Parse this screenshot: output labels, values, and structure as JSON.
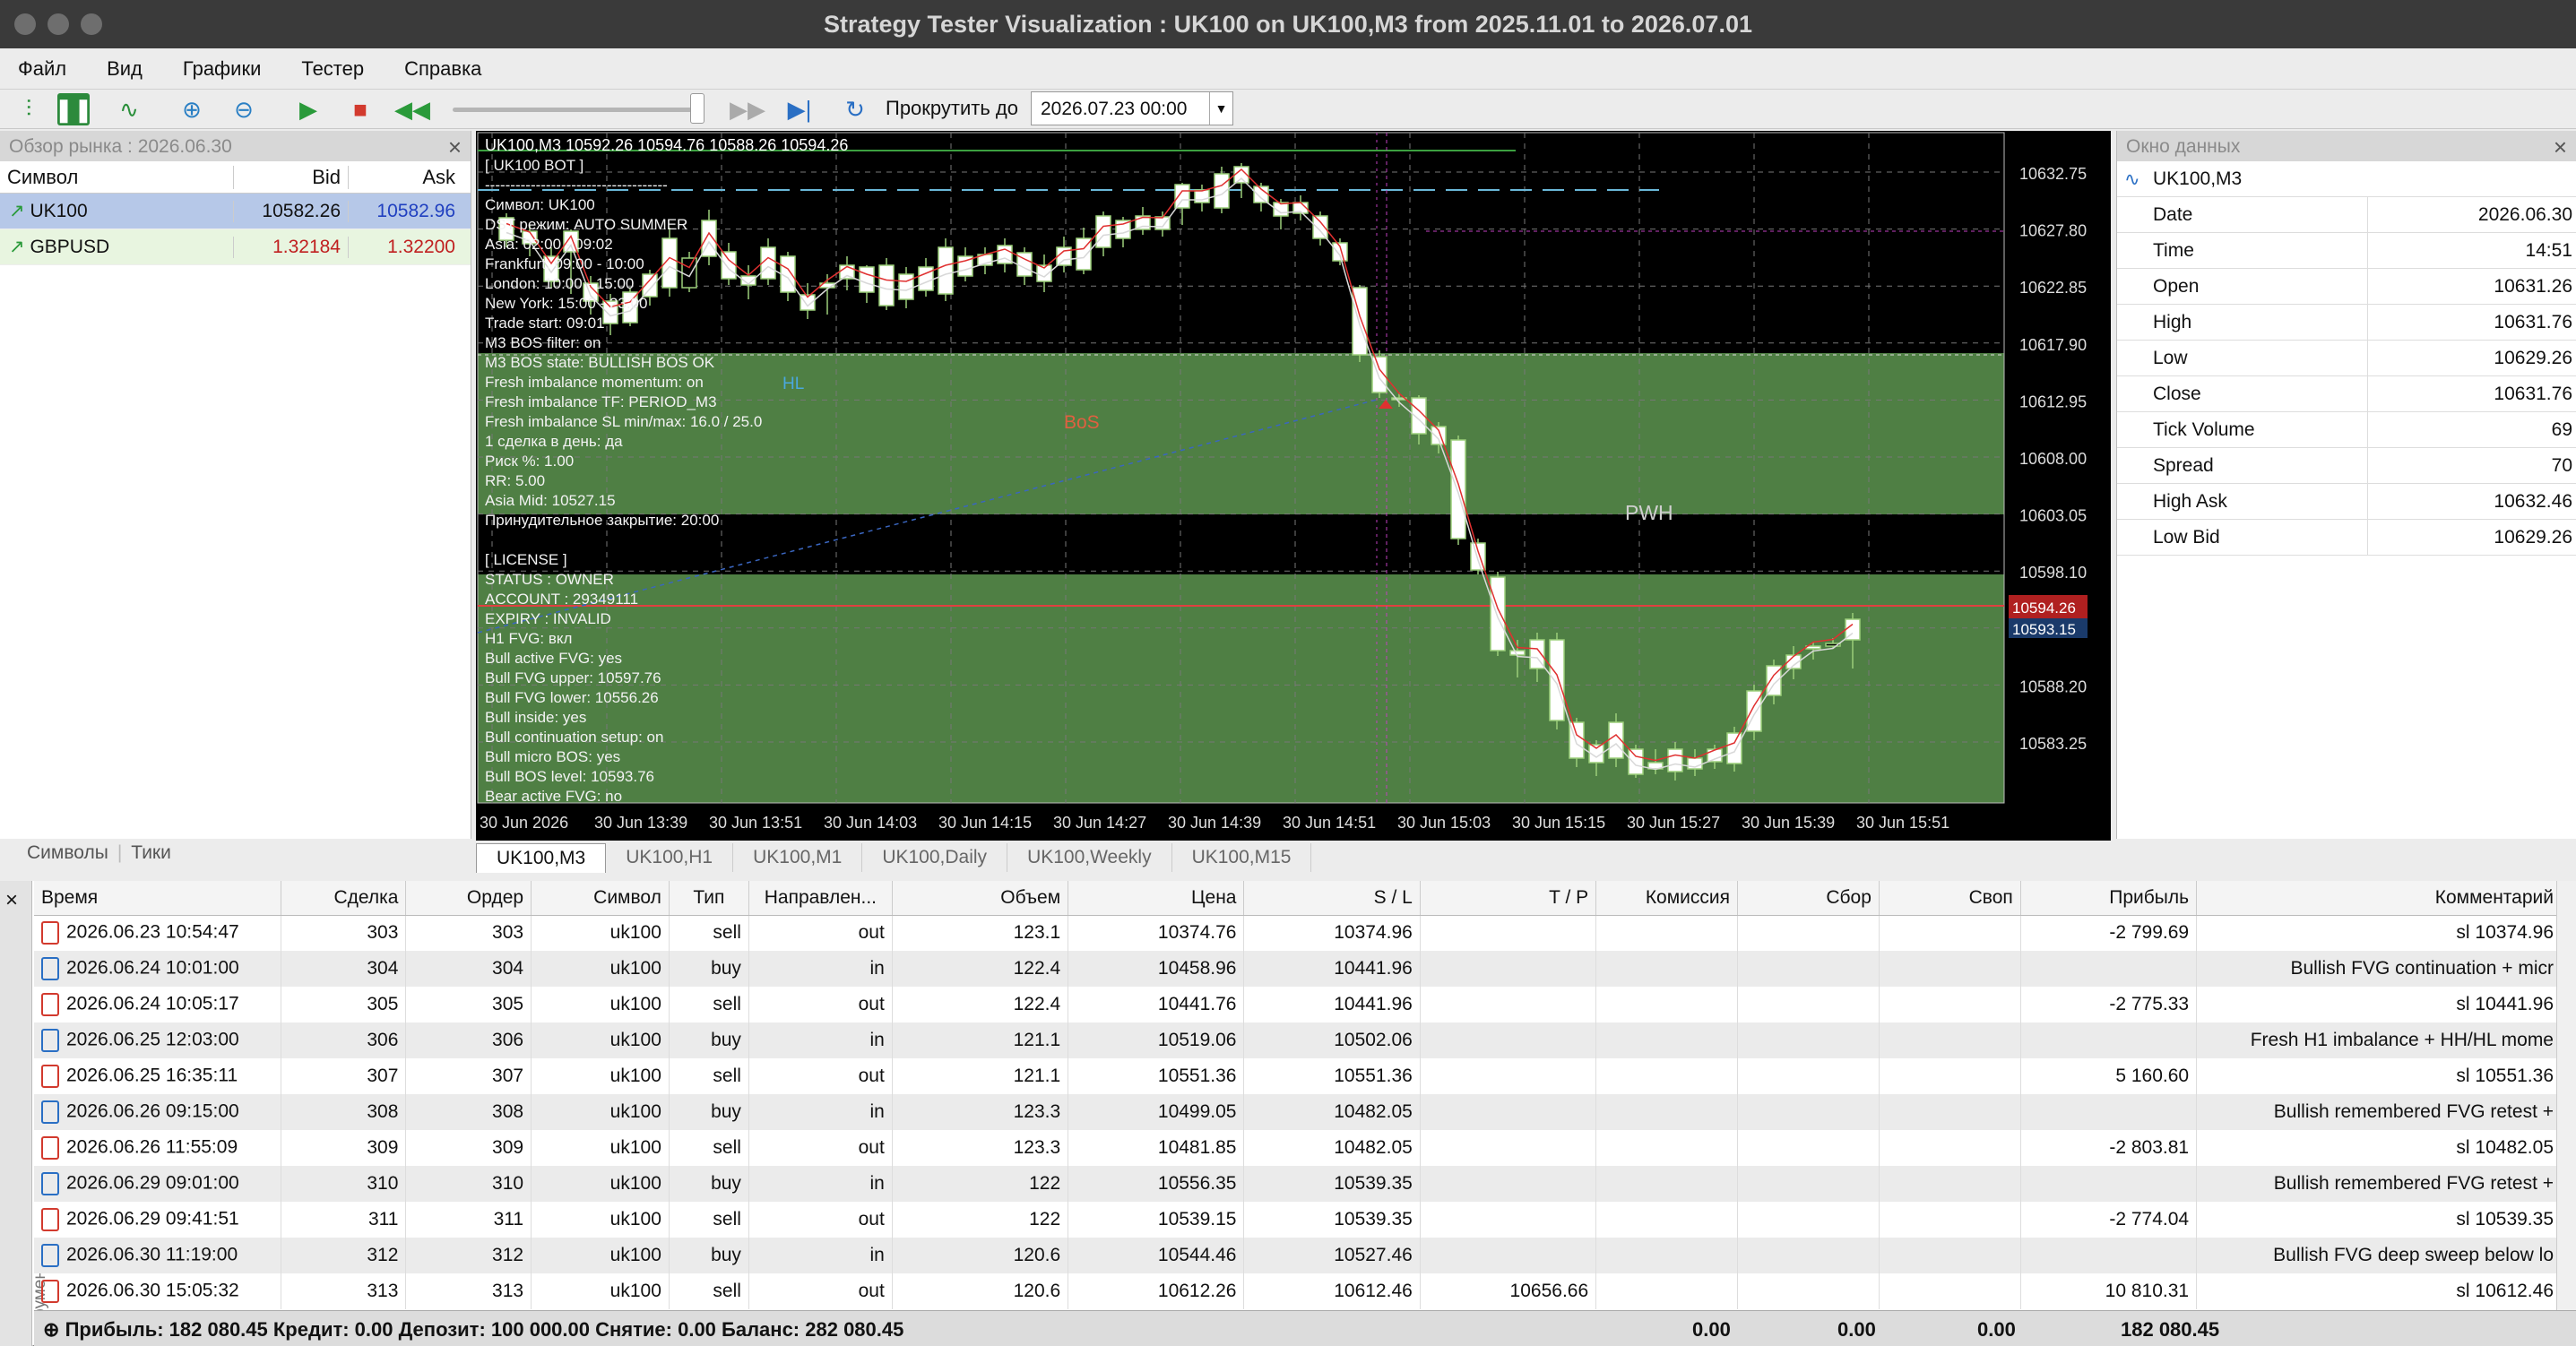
{
  "window": {
    "title": "Strategy Tester Visualization : UK100 on UK100,M3 from 2025.11.01 to 2026.07.01"
  },
  "menu": [
    "Файл",
    "Вид",
    "Графики",
    "Тестер",
    "Справка"
  ],
  "toolbar": {
    "scroll_label": "Прокрутить до",
    "scroll_date": "2026.07.23 00:00"
  },
  "market_watch": {
    "title": "Обзор рынка : 2026.06.30",
    "headers": [
      "Символ",
      "Bid",
      "Ask"
    ],
    "rows": [
      {
        "symbol": "UK100",
        "bid": "10582.26",
        "ask": "10582.96"
      },
      {
        "symbol": "GBPUSD",
        "bid": "1.32184",
        "ask": "1.32200"
      }
    ],
    "tabs": [
      "Символы",
      "Тики"
    ]
  },
  "chart": {
    "header": "UK100,M3  10592.26 10594.76 10588.26 10594.26",
    "info_lines": [
      "[ UK100 BOT ]",
      "------------------------------------",
      "Символ: UK100",
      "DST режим: AUTO SUMMER",
      "Asia: 02:00 - 09:02",
      "Frankfurt: 09:00 - 10:00",
      "London: 10:00 - 15:00",
      "New York: 15:00 - 23:00",
      "Trade start: 09:01",
      "M3 BOS filter: on",
      "M3 BOS state: BULLISH BOS OK",
      "Fresh imbalance momentum: on",
      "Fresh imbalance TF: PERIOD_M3",
      "Fresh imbalance SL min/max: 16.0 / 25.0",
      "1 сделка в день: да",
      "Риск %: 1.00",
      "RR: 5.00",
      "Asia Mid: 10527.15",
      "Принудительное закрытие: 20:00",
      "",
      "[ LICENSE ]",
      "STATUS : OWNER",
      "ACCOUNT : 29349111",
      "EXPIRY : INVALID",
      "H1 FVG: вкл",
      "Bull active FVG: yes",
      "Bull FVG upper: 10597.76",
      "Bull FVG lower: 10556.26",
      "Bull inside: yes",
      "Bull continuation setup: on",
      "Bull micro BOS: yes",
      "Bull BOS level: 10593.76",
      "Bear active FVG: no"
    ],
    "labels": {
      "hl": "HL",
      "bos": "BoS",
      "pwh": "PWH",
      "price_tag": "10594.26",
      "price_tag2": "10593.15"
    },
    "y_ticks": [
      "10632.75",
      "10627.80",
      "10622.85",
      "10617.90",
      "10612.95",
      "10608.00",
      "10603.05",
      "10598.10",
      "10593.15",
      "10588.20",
      "10583.25"
    ],
    "x_ticks": [
      "30 Jun 2026",
      "30 Jun 13:39",
      "30 Jun 13:51",
      "30 Jun 14:03",
      "30 Jun 14:15",
      "30 Jun 14:27",
      "30 Jun 14:39",
      "30 Jun 14:51",
      "30 Jun 15:03",
      "30 Jun 15:15",
      "30 Jun 15:27",
      "30 Jun 15:39",
      "30 Jun 15:51"
    ],
    "tabs": [
      "UK100,M3",
      "UK100,H1",
      "UK100,M1",
      "UK100,Daily",
      "UK100,Weekly",
      "UK100,M15"
    ]
  },
  "data_window": {
    "title": "Окно данных",
    "symbol": "UK100,M3",
    "rows": [
      {
        "k": "Date",
        "v": "2026.06.30"
      },
      {
        "k": "Time",
        "v": "14:51"
      },
      {
        "k": "Open",
        "v": "10631.26"
      },
      {
        "k": "High",
        "v": "10631.76"
      },
      {
        "k": "Low",
        "v": "10629.26"
      },
      {
        "k": "Close",
        "v": "10631.76"
      },
      {
        "k": "Tick Volume",
        "v": "69"
      },
      {
        "k": "Spread",
        "v": "70"
      },
      {
        "k": "High Ask",
        "v": "10632.46"
      },
      {
        "k": "Low Bid",
        "v": "10629.26"
      }
    ]
  },
  "deals": {
    "headers": [
      "Время",
      "Сделка",
      "Ордер",
      "Символ",
      "Тип",
      "Направлен...",
      "Объем",
      "Цена",
      "S / L",
      "T / P",
      "Комиссия",
      "Сбор",
      "Своп",
      "Прибыль",
      "Комментарий"
    ],
    "rows": [
      [
        "2026.06.23 10:54:47",
        "303",
        "303",
        "uk100",
        "sell",
        "out",
        "123.1",
        "10374.76",
        "10374.96",
        "",
        "",
        "",
        "",
        "-2 799.69",
        "sl 10374.96"
      ],
      [
        "2026.06.24 10:01:00",
        "304",
        "304",
        "uk100",
        "buy",
        "in",
        "122.4",
        "10458.96",
        "10441.96",
        "",
        "",
        "",
        "",
        "",
        "Bullish FVG continuation + micr"
      ],
      [
        "2026.06.24 10:05:17",
        "305",
        "305",
        "uk100",
        "sell",
        "out",
        "122.4",
        "10441.76",
        "10441.96",
        "",
        "",
        "",
        "",
        "-2 775.33",
        "sl 10441.96"
      ],
      [
        "2026.06.25 12:03:00",
        "306",
        "306",
        "uk100",
        "buy",
        "in",
        "121.1",
        "10519.06",
        "10502.06",
        "",
        "",
        "",
        "",
        "",
        "Fresh H1 imbalance + HH/HL mome"
      ],
      [
        "2026.06.25 16:35:11",
        "307",
        "307",
        "uk100",
        "sell",
        "out",
        "121.1",
        "10551.36",
        "10551.36",
        "",
        "",
        "",
        "",
        "5 160.60",
        "sl 10551.36"
      ],
      [
        "2026.06.26 09:15:00",
        "308",
        "308",
        "uk100",
        "buy",
        "in",
        "123.3",
        "10499.05",
        "10482.05",
        "",
        "",
        "",
        "",
        "",
        "Bullish remembered FVG retest +"
      ],
      [
        "2026.06.26 11:55:09",
        "309",
        "309",
        "uk100",
        "sell",
        "out",
        "123.3",
        "10481.85",
        "10482.05",
        "",
        "",
        "",
        "",
        "-2 803.81",
        "sl 10482.05"
      ],
      [
        "2026.06.29 09:01:00",
        "310",
        "310",
        "uk100",
        "buy",
        "in",
        "122",
        "10556.35",
        "10539.35",
        "",
        "",
        "",
        "",
        "",
        "Bullish remembered FVG retest +"
      ],
      [
        "2026.06.29 09:41:51",
        "311",
        "311",
        "uk100",
        "sell",
        "out",
        "122",
        "10539.15",
        "10539.35",
        "",
        "",
        "",
        "",
        "-2 774.04",
        "sl 10539.35"
      ],
      [
        "2026.06.30 11:19:00",
        "312",
        "312",
        "uk100",
        "buy",
        "in",
        "120.6",
        "10544.46",
        "10527.46",
        "",
        "",
        "",
        "",
        "",
        "Bullish FVG deep sweep below lo"
      ],
      [
        "2026.06.30 15:05:32",
        "313",
        "313",
        "uk100",
        "sell",
        "out",
        "120.6",
        "10612.26",
        "10612.46",
        "10656.66",
        "",
        "",
        "",
        "10 810.31",
        "sl 10612.46"
      ]
    ]
  },
  "footer": {
    "summary": "Прибыль: 182 080.45  Кредит: 0.00  Депозит: 100 000.00  Снятие: 0.00  Баланс: 282 080.45",
    "commission": "0.00",
    "fee": "0.00",
    "swap": "0.00",
    "profit": "182 080.45"
  },
  "side_label": "Инструменты"
}
